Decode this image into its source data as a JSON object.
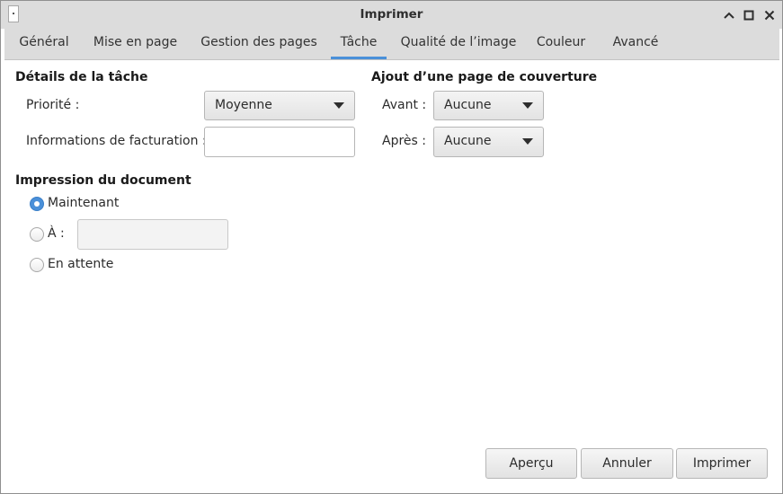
{
  "window": {
    "title": "Imprimer"
  },
  "tabs": [
    {
      "label": "Général"
    },
    {
      "label": "Mise en page"
    },
    {
      "label": "Gestion des pages"
    },
    {
      "label": "Tâche",
      "active": true
    },
    {
      "label": "Qualité de l’image"
    },
    {
      "label": "Couleur"
    },
    {
      "label": "Avancé"
    }
  ],
  "job_details": {
    "heading": "Détails de la tâche",
    "priority_label": "Priorité :",
    "priority_value": "Moyenne",
    "billing_label": "Informations de facturation :",
    "billing_value": ""
  },
  "cover_page": {
    "heading": "Ajout d’une page de couverture",
    "before_label": "Avant :",
    "before_value": "Aucune",
    "after_label": "Après :",
    "after_value": "Aucune"
  },
  "print_document": {
    "heading": "Impression du document",
    "now_label": "Maintenant",
    "now_selected": true,
    "at_label": "À :",
    "at_value": "",
    "hold_label": "En attente"
  },
  "buttons": {
    "preview": "Aperçu",
    "cancel": "Annuler",
    "print": "Imprimer"
  },
  "colors": {
    "accent": "#4a90d9"
  }
}
